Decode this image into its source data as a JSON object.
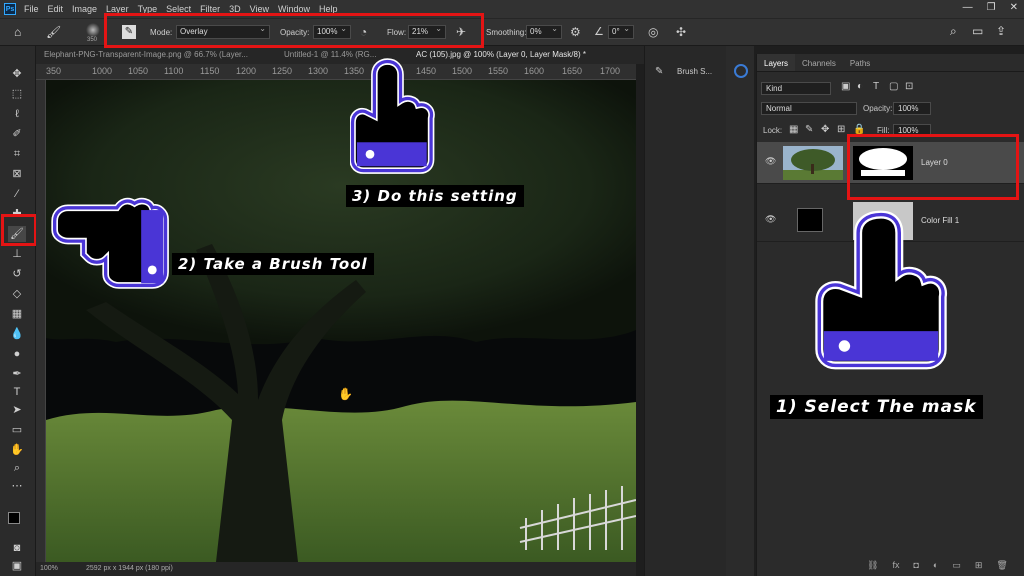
{
  "menubar": {
    "logo": "Ps",
    "items": [
      "File",
      "Edit",
      "Image",
      "Layer",
      "Type",
      "Select",
      "Filter",
      "3D",
      "View",
      "Window",
      "Help"
    ],
    "min": "—",
    "max": "❐",
    "close": "✕"
  },
  "options": {
    "brush_size": "350",
    "mode_label": "Mode:",
    "mode_value": "Overlay",
    "opacity_label": "Opacity:",
    "opacity_value": "100%",
    "flow_label": "Flow:",
    "flow_value": "21%",
    "smoothing_label": "Smoothing:",
    "smoothing_value": "0%",
    "angle_value": "0°"
  },
  "tabs": [
    "Elephant-PNG-Transparent-Image.png @ 66.7% (Layer...",
    "Untitled-1 @ 11.4% (RG...",
    "AC (105).jpg @ 100% (Layer 0, Layer Mask/8) *"
  ],
  "ruler": [
    "350",
    "1000",
    "1050",
    "1100",
    "1150",
    "1200",
    "1250",
    "1300",
    "1350",
    "1400",
    "1450",
    "1500",
    "1550",
    "1600",
    "1650",
    "1700"
  ],
  "status": {
    "zoom": "100%",
    "doc": "2592 px x 1944 px (180 ppi)"
  },
  "midpanel": {
    "brush_settings": "Brush S..."
  },
  "layers": {
    "tabs": [
      "Layers",
      "Channels",
      "Paths"
    ],
    "kind": "Kind",
    "blend": "Normal",
    "opacity_label": "Opacity:",
    "opacity_value": "100%",
    "lock_label": "Lock:",
    "fill_label": "Fill:",
    "fill_value": "100%",
    "rows": [
      {
        "name": "Layer 0"
      },
      {
        "name": "Color Fill 1"
      }
    ],
    "footer": [
      "⛓",
      "fx",
      "◘",
      "◐",
      "▭",
      "⊞",
      "🗑"
    ]
  },
  "annotations": {
    "step1": "1) Select The mask",
    "step2": "2) Take a Brush Tool",
    "step3": "3) Do this setting"
  },
  "colors": {
    "accent_red": "#e41414",
    "hand_blue": "#4a35d6"
  }
}
